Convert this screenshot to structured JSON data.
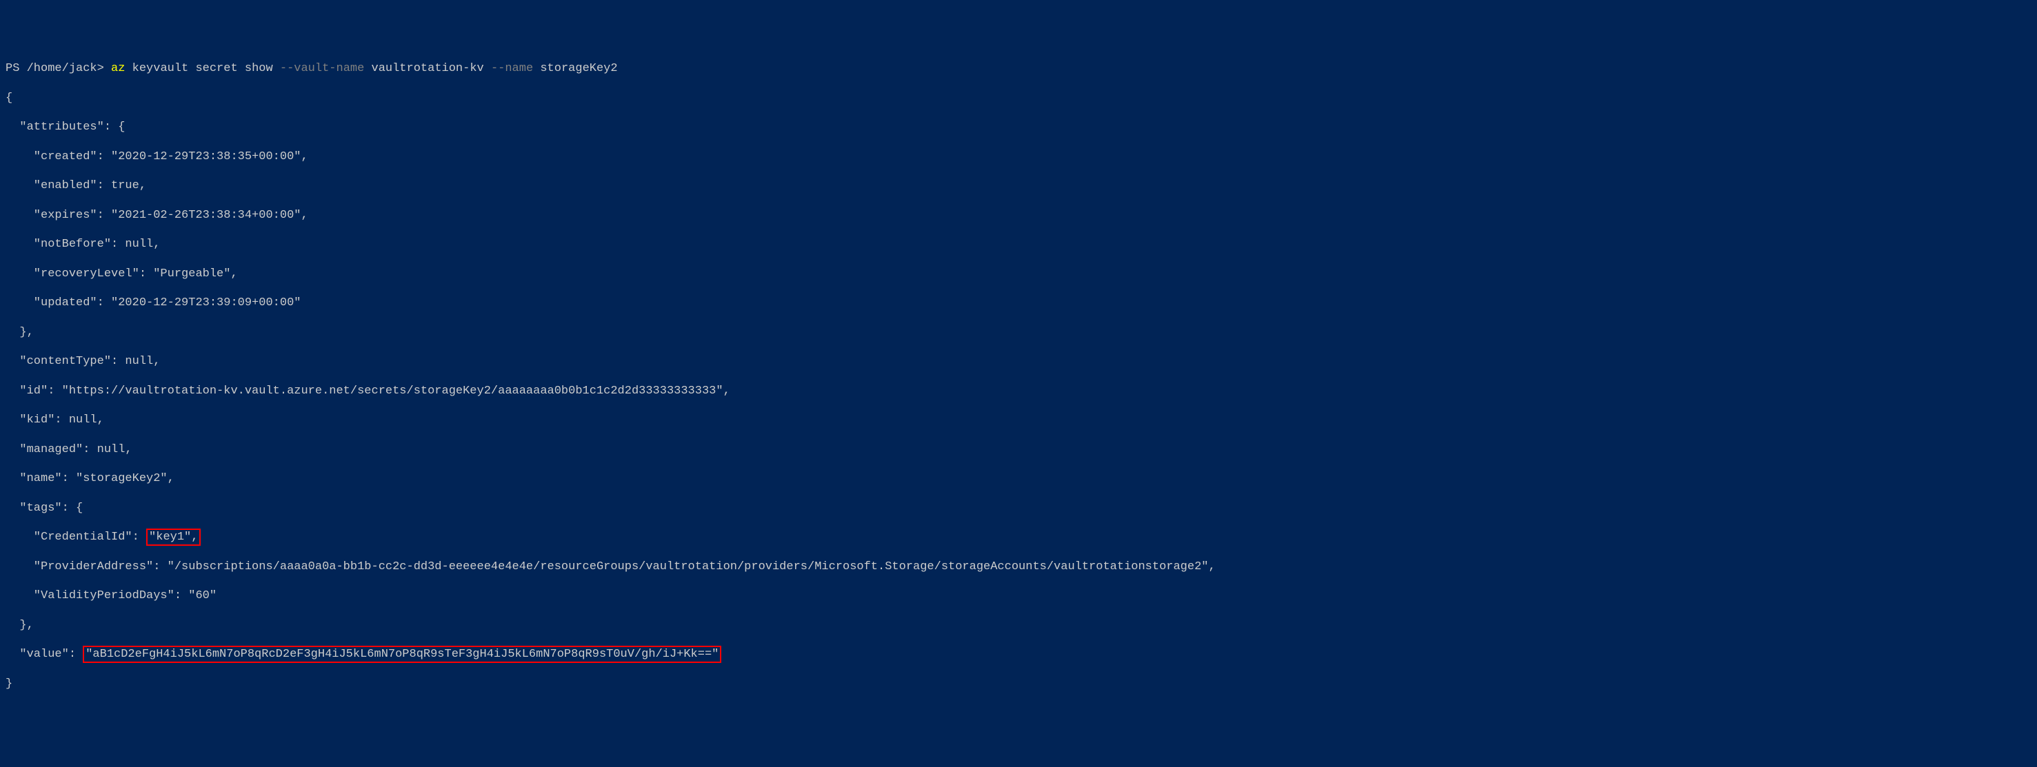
{
  "prompt": {
    "prefix": "PS /home/jack> ",
    "cmd": "az",
    "args_white1": " keyvault secret show ",
    "param1": "--vault-name",
    "val1": " vaultrotation-kv ",
    "param2": "--name",
    "val2": " storageKey2"
  },
  "output": {
    "l1": "{",
    "l2": "  \"attributes\": {",
    "l3": "    \"created\": \"2020-12-29T23:38:35+00:00\",",
    "l4": "    \"enabled\": true,",
    "l5": "    \"expires\": \"2021-02-26T23:38:34+00:00\",",
    "l6": "    \"notBefore\": null,",
    "l7": "    \"recoveryLevel\": \"Purgeable\",",
    "l8": "    \"updated\": \"2020-12-29T23:39:09+00:00\"",
    "l9": "  },",
    "l10": "  \"contentType\": null,",
    "l11": "  \"id\": \"https://vaultrotation-kv.vault.azure.net/secrets/storageKey2/aaaaaaaa0b0b1c1c2d2d33333333333\",",
    "l12": "  \"kid\": null,",
    "l13": "  \"managed\": null,",
    "l14": "  \"name\": \"storageKey2\",",
    "l15": "  \"tags\": {",
    "l16a": "    \"CredentialId\": ",
    "l16b": "\"key1\",",
    "l17": "    \"ProviderAddress\": \"/subscriptions/aaaa0a0a-bb1b-cc2c-dd3d-eeeeee4e4e4e/resourceGroups/vaultrotation/providers/Microsoft.Storage/storageAccounts/vaultrotationstorage2\",",
    "l18": "    \"ValidityPeriodDays\": \"60\"",
    "l19": "  },",
    "l20a": "  \"value\": ",
    "l20b": "\"aB1cD2eFgH4iJ5kL6mN7oP8qRcD2eF3gH4iJ5kL6mN7oP8qR9sTeF3gH4iJ5kL6mN7oP8qR9sT0uV/gh/iJ+Kk==\"",
    "l21": "}"
  }
}
